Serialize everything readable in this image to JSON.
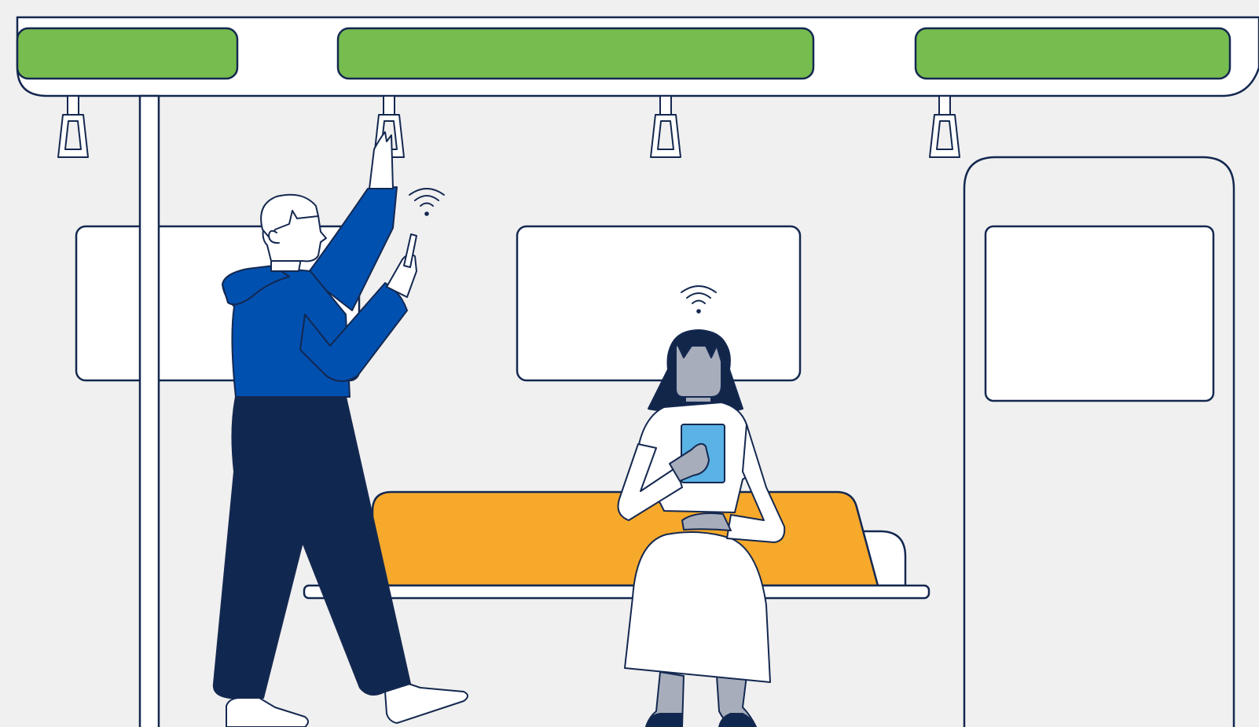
{
  "colors": {
    "background": "#f0f0f0",
    "outline": "#142850",
    "panel_white": "#ffffff",
    "light_strip_green": "#76bc4f",
    "seat_orange": "#f7a92b",
    "hoodie_blue": "#0050b0",
    "pants_navy": "#10284f",
    "skin_gray": "#a7adbb",
    "tablet_blue": "#5ab2e5",
    "hair_navy": "#12264a"
  },
  "icons": {
    "wifi_above_man": "wifi-icon",
    "wifi_above_woman": "wifi-icon"
  }
}
